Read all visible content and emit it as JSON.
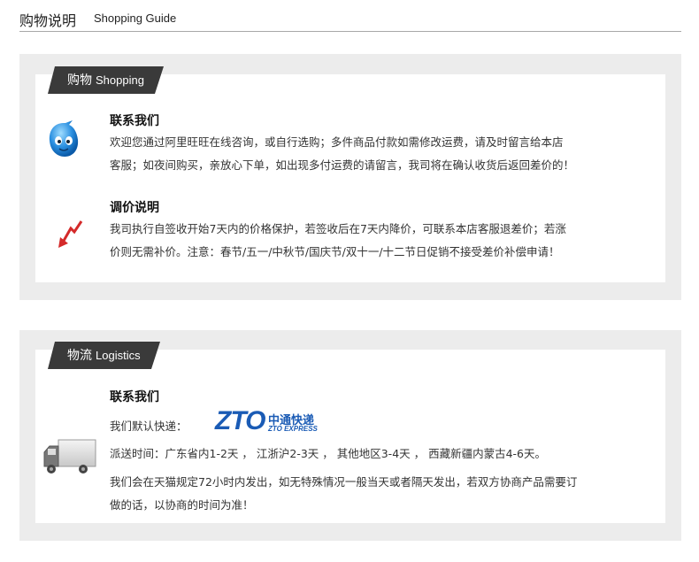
{
  "header": {
    "title_cn": "购物说明",
    "title_en": "Shopping Guide"
  },
  "shopping": {
    "tab_cn": "购物",
    "tab_en": "Shopping",
    "contact": {
      "title": "联系我们",
      "line1": "欢迎您通过阿里旺旺在线咨询，或自行选购；多件商品付款如需修改运费，请及时留言给本店",
      "line2": "客服；如夜间购买，亲放心下单，如出现多付运费的请留言，我司将在确认收货后返回差价的！"
    },
    "price": {
      "title": "调价说明",
      "line1": "我司执行自签收开始7天内的价格保护，若签收后在7天内降价，可联系本店客服退差价；若涨",
      "line2": "价则无需补价。注意：春节/五一/中秋节/国庆节/双十一/十二节日促销不接受差价补偿申请！"
    }
  },
  "logistics": {
    "tab_cn": "物流",
    "tab_en": "Logistics",
    "title": "联系我们",
    "default_label": "我们默认快递：",
    "zto_logo": "ZTO",
    "zto_cn": "中通快递",
    "zto_en": "ZTO EXPRESS",
    "delivery": "派送时间：广东省内1-2天 ， 江浙沪2-3天 ， 其他地区3-4天 ， 西藏新疆内蒙古4-6天。",
    "line1": "我们会在天猫规定72小时内发出，如无特殊情况一般当天或者隔天发出，若双方协商产品需要订",
    "line2": "做的话，以协商的时间为准！"
  },
  "colors": {
    "tab_bg": "#3a3a3a",
    "panel_bg": "#ececec",
    "zto_blue": "#1a5bb5",
    "arrow_red": "#d42a2a"
  }
}
